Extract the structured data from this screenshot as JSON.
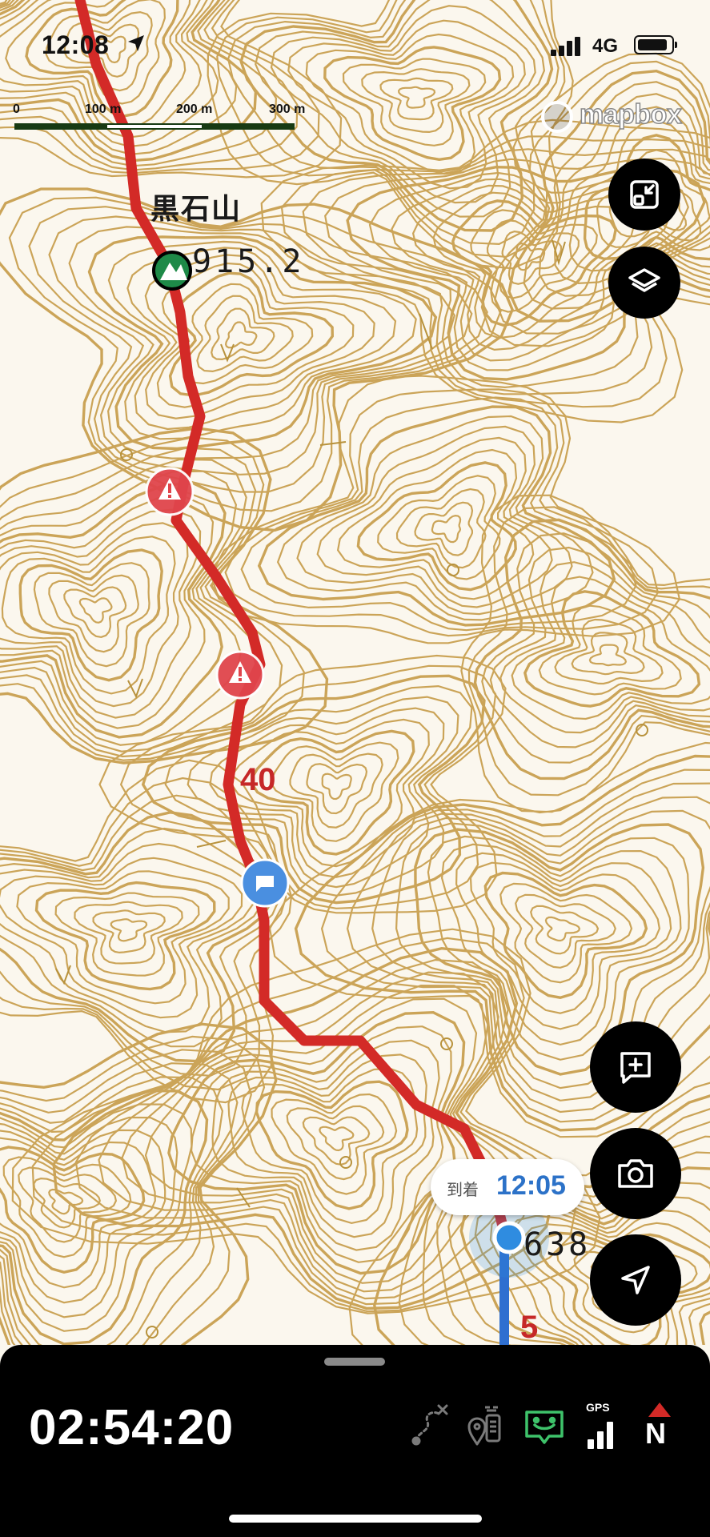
{
  "status_bar": {
    "time": "12:08",
    "network": "4G",
    "battery_level": 0.9
  },
  "scale_bar": {
    "labels": [
      "0",
      "100 m",
      "200 m",
      "300 m"
    ]
  },
  "attribution": {
    "text": "mapbox"
  },
  "map": {
    "peak": {
      "name": "黒石山",
      "elevation": "915.2"
    },
    "spot_elevation": "638",
    "route_markers": [
      "40",
      "5"
    ],
    "colors": {
      "route": "#d32a27",
      "track": "#2f6fd0",
      "contour": "#c9a051",
      "peak_marker": "#1e8a48",
      "warning": "#e0454c"
    }
  },
  "eta": {
    "label": "到着",
    "time": "12:05"
  },
  "controls": {
    "top": [
      "fullscreen-icon",
      "layers-icon"
    ],
    "bottom": [
      "add-note-icon",
      "camera-icon",
      "locate-icon"
    ]
  },
  "bottom_panel": {
    "elapsed": "02:54:20",
    "icons": [
      "route-off-icon",
      "phone-location-icon",
      "message-icon",
      "gps-signal-icon",
      "north-compass-icon"
    ],
    "gps_label": "GPS",
    "compass_label": "N"
  }
}
